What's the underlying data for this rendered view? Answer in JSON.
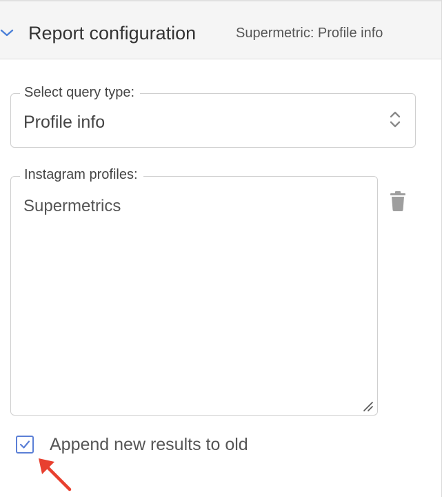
{
  "header": {
    "title": "Report configuration",
    "subtitle": "Supermetric: Profile info",
    "collapse_icon": "chevron-down-icon"
  },
  "query_type": {
    "legend": "Select query type:",
    "value": "Profile info",
    "icon": "updown-chevrons-icon"
  },
  "profiles": {
    "legend": "Instagram profiles:",
    "value": "Supermetrics",
    "delete_icon": "trash-icon"
  },
  "append": {
    "label": "Append new results to old",
    "checked": true
  },
  "colors": {
    "accent": "#5b7fd6",
    "annotation_arrow": "#e8402f"
  }
}
